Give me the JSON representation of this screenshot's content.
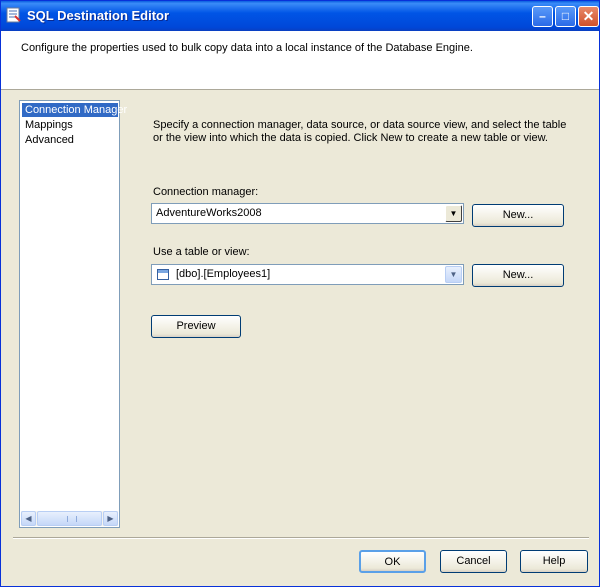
{
  "window": {
    "title": "SQL Destination Editor",
    "minimize_glyph": "–",
    "maximize_glyph": "□",
    "close_glyph": "✕"
  },
  "header": {
    "text": "Configure the properties used to bulk copy data into a local instance of the Database Engine."
  },
  "nav": {
    "items": [
      {
        "label": "Connection Manager",
        "selected": true
      },
      {
        "label": "Mappings",
        "selected": false
      },
      {
        "label": "Advanced",
        "selected": false
      }
    ],
    "scroll_left": "◀",
    "scroll_right": "▶"
  },
  "main": {
    "description": "Specify a connection manager, data source, or data source view, and select the table or the view into which the data is copied. Click New to create a new table or view.",
    "connection_manager": {
      "label": "Connection manager:",
      "value": "AdventureWorks2008",
      "new_label": "New..."
    },
    "table_or_view": {
      "label": "Use a table or view:",
      "value": "[dbo].[Employees1]",
      "new_label": "New..."
    },
    "preview_label": "Preview",
    "dropdown_arrow": "▼"
  },
  "footer": {
    "ok_label": "OK",
    "cancel_label": "Cancel",
    "help_label": "Help"
  },
  "colors": {
    "titlebar": "#0055e6",
    "selection": "#316ac5",
    "dialog_bg": "#ece9d8"
  },
  "icons": [
    "app-icon",
    "minimize-icon",
    "maximize-icon",
    "close-icon",
    "table-icon",
    "chevron-down-icon",
    "chevron-left-icon",
    "chevron-right-icon"
  ]
}
